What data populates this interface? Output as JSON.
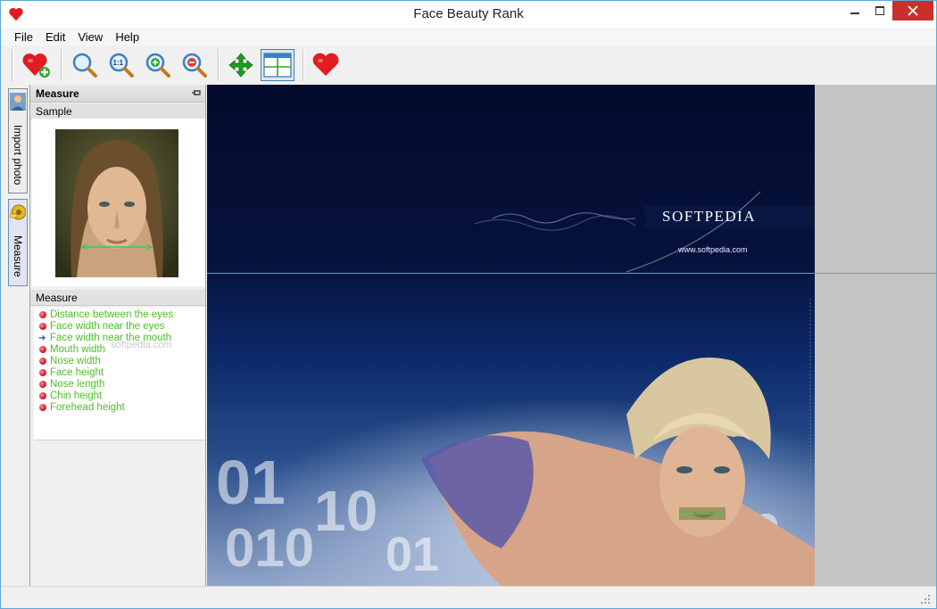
{
  "window": {
    "title": "Face Beauty Rank"
  },
  "menu": [
    "File",
    "Edit",
    "View",
    "Help"
  ],
  "side_tabs": {
    "import": "Import photo",
    "measure": "Measure"
  },
  "panel": {
    "title": "Measure",
    "sample_label": "Sample",
    "measure_label": "Measure",
    "watermark": "softpedia.com",
    "items": [
      "Distance between the eyes",
      "Face width near the eyes",
      "Face width near the mouth",
      "Mouth width",
      "Nose width",
      "Face height",
      "Nose length",
      "Chin height",
      "Forehead height"
    ],
    "current_item_index": 2
  },
  "canvas": {
    "brand": "SOFTPEDIA",
    "brand_url": "www.softpedia.com"
  },
  "colors": {
    "accent_green": "#4cbe2c",
    "line_green": "#3ac85a",
    "heart_red": "#e11b22"
  },
  "icons": {
    "toolbar": [
      "heart-add-icon",
      "zoom-icon",
      "zoom-actual-icon",
      "zoom-in-icon",
      "zoom-out-icon",
      "move-icon",
      "grid-icon",
      "heart-icon"
    ]
  }
}
